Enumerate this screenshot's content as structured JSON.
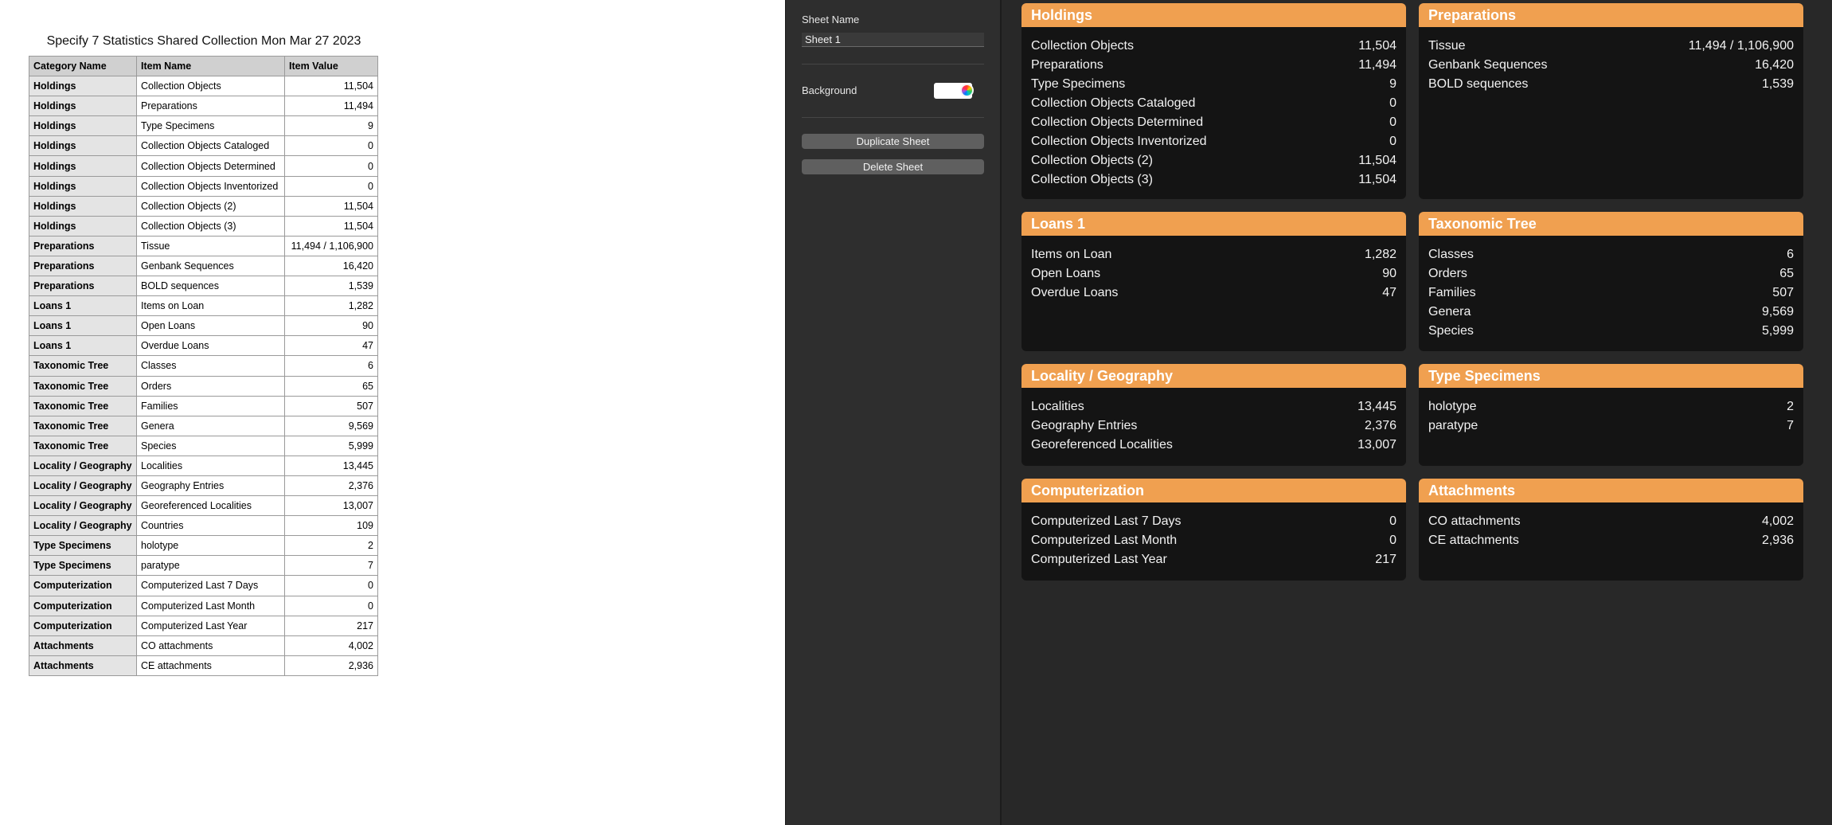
{
  "sheet": {
    "title": "Specify 7 Statistics Shared Collection Mon Mar 27 2023",
    "headers": [
      "Category Name",
      "Item Name",
      "Item Value"
    ],
    "rows": [
      {
        "cat": "Holdings",
        "item": "Collection Objects",
        "val": "11,504"
      },
      {
        "cat": "Holdings",
        "item": "Preparations",
        "val": "11,494"
      },
      {
        "cat": "Holdings",
        "item": "Type Specimens",
        "val": "9"
      },
      {
        "cat": "Holdings",
        "item": "Collection Objects Cataloged",
        "val": "0"
      },
      {
        "cat": "Holdings",
        "item": "Collection Objects Determined",
        "val": "0"
      },
      {
        "cat": "Holdings",
        "item": "Collection Objects Inventorized",
        "val": "0"
      },
      {
        "cat": "Holdings",
        "item": "Collection Objects (2)",
        "val": "11,504"
      },
      {
        "cat": "Holdings",
        "item": "Collection Objects (3)",
        "val": "11,504"
      },
      {
        "cat": "Preparations",
        "item": "Tissue",
        "val": "11,494 / 1,106,900"
      },
      {
        "cat": "Preparations",
        "item": "Genbank Sequences",
        "val": "16,420"
      },
      {
        "cat": "Preparations",
        "item": "BOLD sequences",
        "val": "1,539"
      },
      {
        "cat": "Loans 1",
        "item": "Items on Loan",
        "val": "1,282"
      },
      {
        "cat": "Loans 1",
        "item": "Open Loans",
        "val": "90"
      },
      {
        "cat": "Loans 1",
        "item": "Overdue Loans",
        "val": "47"
      },
      {
        "cat": "Taxonomic Tree",
        "item": "Classes",
        "val": "6"
      },
      {
        "cat": "Taxonomic Tree",
        "item": "Orders",
        "val": "65"
      },
      {
        "cat": "Taxonomic Tree",
        "item": "Families",
        "val": "507"
      },
      {
        "cat": "Taxonomic Tree",
        "item": "Genera",
        "val": "9,569"
      },
      {
        "cat": "Taxonomic Tree",
        "item": "Species",
        "val": "5,999"
      },
      {
        "cat": "Locality / Geography",
        "item": "Localities",
        "val": "13,445"
      },
      {
        "cat": "Locality / Geography",
        "item": "Geography Entries",
        "val": "2,376"
      },
      {
        "cat": "Locality / Geography",
        "item": "Georeferenced Localities",
        "val": "13,007"
      },
      {
        "cat": "Locality / Geography",
        "item": "Countries",
        "val": "109"
      },
      {
        "cat": "Type Specimens",
        "item": "holotype",
        "val": "2"
      },
      {
        "cat": "Type Specimens",
        "item": "paratype",
        "val": "7"
      },
      {
        "cat": "Computerization",
        "item": "Computerized Last 7 Days",
        "val": "0"
      },
      {
        "cat": "Computerization",
        "item": "Computerized Last Month",
        "val": "0"
      },
      {
        "cat": "Computerization",
        "item": "Computerized Last Year",
        "val": "217"
      },
      {
        "cat": "Attachments",
        "item": "CO attachments",
        "val": "4,002"
      },
      {
        "cat": "Attachments",
        "item": "CE attachments",
        "val": "2,936"
      }
    ]
  },
  "controls": {
    "sheet_name_label": "Sheet Name",
    "sheet_name_value": "Sheet 1",
    "background_label": "Background",
    "background_color": "#ffffff",
    "duplicate_label": "Duplicate Sheet",
    "delete_label": "Delete Sheet"
  },
  "dashboard": {
    "accent_color": "#f0a050",
    "cards": {
      "holdings": {
        "title": "Holdings",
        "items": [
          {
            "name": "Collection Objects",
            "value": "11,504"
          },
          {
            "name": "Preparations",
            "value": "11,494"
          },
          {
            "name": "Type Specimens",
            "value": "9"
          },
          {
            "name": "Collection Objects Cataloged",
            "value": "0"
          },
          {
            "name": "Collection Objects Determined",
            "value": "0"
          },
          {
            "name": "Collection Objects Inventorized",
            "value": "0"
          },
          {
            "name": "Collection Objects (2)",
            "value": "11,504"
          },
          {
            "name": "Collection Objects (3)",
            "value": "11,504"
          }
        ]
      },
      "preparations": {
        "title": "Preparations",
        "items": [
          {
            "name": "Tissue",
            "value": "11,494 / 1,106,900"
          },
          {
            "name": "Genbank Sequences",
            "value": "16,420"
          },
          {
            "name": "BOLD sequences",
            "value": "1,539"
          }
        ]
      },
      "loans": {
        "title": "Loans 1",
        "items": [
          {
            "name": "Items on Loan",
            "value": "1,282"
          },
          {
            "name": "Open Loans",
            "value": "90"
          },
          {
            "name": "Overdue Loans",
            "value": "47"
          }
        ]
      },
      "taxonomic": {
        "title": "Taxonomic Tree",
        "items": [
          {
            "name": "Classes",
            "value": "6"
          },
          {
            "name": "Orders",
            "value": "65"
          },
          {
            "name": "Families",
            "value": "507"
          },
          {
            "name": "Genera",
            "value": "9,569"
          },
          {
            "name": "Species",
            "value": "5,999"
          }
        ]
      },
      "locality": {
        "title": "Locality / Geography",
        "items": [
          {
            "name": "Localities",
            "value": "13,445"
          },
          {
            "name": "Geography Entries",
            "value": "2,376"
          },
          {
            "name": "Georeferenced Localities",
            "value": "13,007"
          }
        ]
      },
      "typespec": {
        "title": "Type Specimens",
        "items": [
          {
            "name": "holotype",
            "value": "2"
          },
          {
            "name": "paratype",
            "value": "7"
          }
        ]
      },
      "computerization": {
        "title": "Computerization",
        "items": [
          {
            "name": "Computerized Last 7 Days",
            "value": "0"
          },
          {
            "name": "Computerized Last Month",
            "value": "0"
          },
          {
            "name": "Computerized Last Year",
            "value": "217"
          }
        ]
      },
      "attachments": {
        "title": "Attachments",
        "items": [
          {
            "name": "CO attachments",
            "value": "4,002"
          },
          {
            "name": "CE attachments",
            "value": "2,936"
          }
        ]
      }
    }
  }
}
